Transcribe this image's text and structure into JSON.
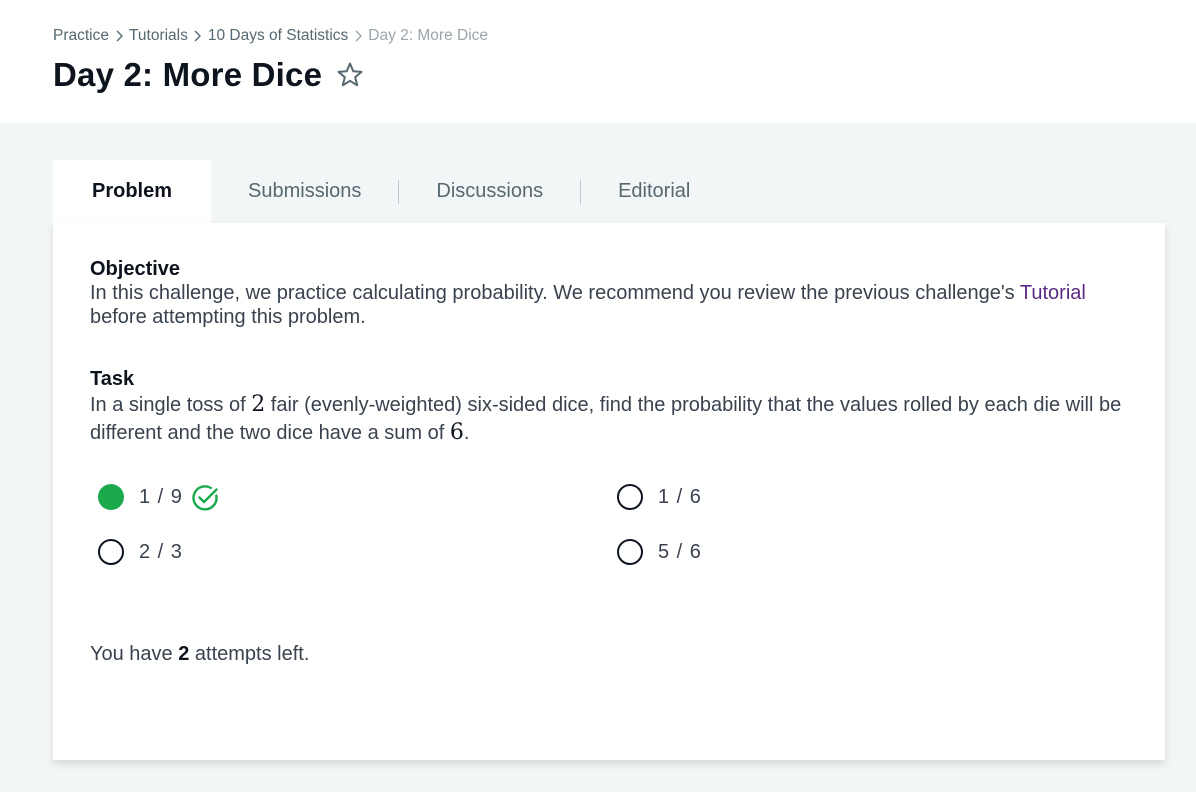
{
  "breadcrumb": {
    "items": [
      "Practice",
      "Tutorials",
      "10 Days of Statistics"
    ],
    "current": "Day 2: More Dice"
  },
  "page": {
    "title": "Day 2: More Dice"
  },
  "tabs": [
    {
      "label": "Problem",
      "active": true
    },
    {
      "label": "Submissions",
      "active": false
    },
    {
      "label": "Discussions",
      "active": false
    },
    {
      "label": "Editorial",
      "active": false
    }
  ],
  "objective": {
    "heading": "Objective",
    "text_before": "In this challenge, we practice calculating probability. We recommend you review the previous challenge's ",
    "link": "Tutorial",
    "text_after": " before attempting this problem."
  },
  "task": {
    "heading": "Task",
    "text_1": "In a single toss of ",
    "num_dice": "2",
    "text_2": " fair (evenly-weighted) six-sided dice, find the probability that the values rolled by each die will be different and the two dice have a sum of ",
    "sum": "6",
    "text_3": "."
  },
  "options": [
    {
      "label": "1 / 9",
      "selected": true,
      "correct": true
    },
    {
      "label": "1 / 6",
      "selected": false
    },
    {
      "label": "2 / 3",
      "selected": false
    },
    {
      "label": "5 / 6",
      "selected": false
    }
  ],
  "attempts": {
    "prefix": "You have ",
    "count": "2",
    "suffix": " attempts left."
  },
  "colors": {
    "accent_green": "#1ba94c",
    "link_purple": "#5b2c83",
    "background": "#f3f6f7"
  },
  "icons": {
    "star": "star-outline-icon",
    "check": "check-circle-icon",
    "chevron": "chevron-right-icon"
  }
}
